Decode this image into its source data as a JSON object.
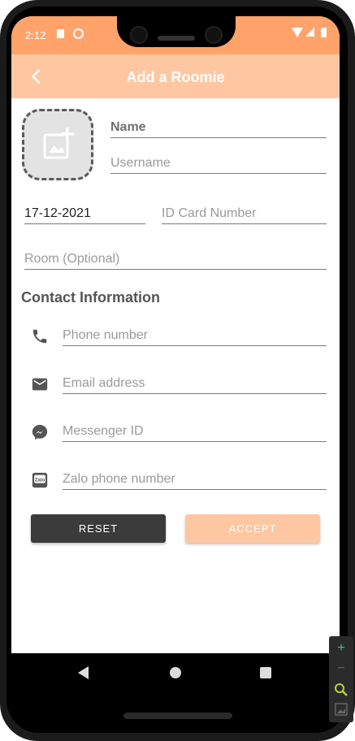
{
  "status_bar": {
    "time": "2:12"
  },
  "app_bar": {
    "title": "Add a Roomie"
  },
  "form": {
    "name_placeholder": "Name",
    "username_placeholder": "Username",
    "birth_date_value": "17-12-2021",
    "id_card_placeholder": "ID Card Number",
    "room_placeholder": "Room (Optional)"
  },
  "contact": {
    "section_title": "Contact Information",
    "phone_placeholder": "Phone number",
    "email_placeholder": "Email address",
    "messenger_placeholder": "Messenger ID",
    "zalo_placeholder": "Zalo phone number",
    "zalo_icon_text": "Zalo"
  },
  "buttons": {
    "reset_label": "RESET",
    "accept_label": "ACCEPT"
  },
  "side_tools": {
    "zoom_in": "+",
    "zoom_out": "−"
  },
  "colors": {
    "status_bar": "#ffa36b",
    "app_bar": "#ffc7a1",
    "reset_button": "#3b3b3b",
    "accept_button": "#ffc7a1"
  },
  "icons": [
    "back-arrow-icon",
    "add-photo-icon",
    "phone-icon",
    "email-icon",
    "messenger-icon",
    "zalo-icon",
    "zoom-in-icon",
    "zoom-out-icon",
    "search-zoom-icon",
    "image-icon"
  ]
}
